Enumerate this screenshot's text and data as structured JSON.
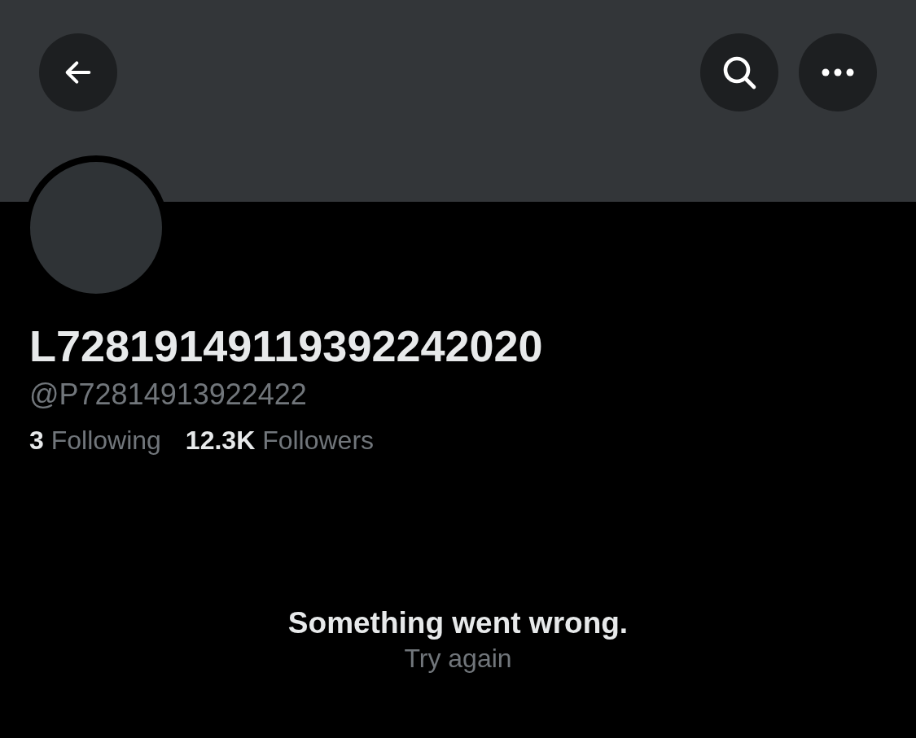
{
  "profile": {
    "name": "L72819149119392242020",
    "handle": "@P72814913922422"
  },
  "stats": [
    {
      "count": "3",
      "label": "Following"
    },
    {
      "count": "12.3K",
      "label": "Followers"
    }
  ],
  "error": {
    "message": "Something went wrong.",
    "action": "Try again"
  }
}
